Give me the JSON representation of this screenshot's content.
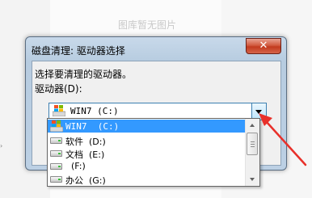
{
  "background": {
    "caption": "图库暂无图片"
  },
  "dialog": {
    "title": "磁盘清理: 驱动器选择",
    "close_glyph": "✕",
    "prompt": "选择要清理的驱动器。",
    "drives_label": "驱动器(D):",
    "selected_drive": "WIN7  (C:)",
    "drives": [
      {
        "label": "WIN7  (C:)",
        "icon": "windows-drive-icon",
        "selected": true
      },
      {
        "label": "软件  (D:)",
        "icon": "hard-disk-icon",
        "selected": false
      },
      {
        "label": "文档  (E:)",
        "icon": "hard-disk-icon",
        "selected": false
      },
      {
        "label": "  (F:)",
        "icon": "hard-disk-icon",
        "selected": false
      },
      {
        "label": "办公  (G:)",
        "icon": "hard-disk-icon",
        "selected": false
      }
    ]
  },
  "colors": {
    "selection": "#3399ff",
    "annotation": "#e8302a",
    "close_button": "#c94127"
  }
}
